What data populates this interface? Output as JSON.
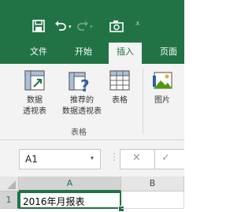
{
  "titlebar": {
    "quick_access": {
      "save_icon": "save-icon",
      "undo_icon": "undo-icon",
      "redo_icon": "redo-icon",
      "camera_icon": "camera-icon",
      "customize_icon": "customize-qat-icon"
    },
    "tabs": [
      {
        "label": "文件"
      },
      {
        "label": "开始"
      },
      {
        "label": "插入",
        "active": true
      },
      {
        "label": "页面"
      }
    ]
  },
  "ribbon": {
    "group_tables": {
      "label": "表格",
      "buttons": [
        {
          "label_line1": "数据",
          "label_line2": "透视表",
          "icon": "pivottable-icon"
        },
        {
          "label_line1": "推荐的",
          "label_line2": "数据透视表",
          "icon": "recommended-pivottable-icon"
        },
        {
          "label_line1": "表格",
          "label_line2": "",
          "icon": "table-icon"
        }
      ]
    },
    "group_illustrations": {
      "buttons": [
        {
          "label_line1": "图片",
          "icon": "picture-icon"
        }
      ]
    }
  },
  "formula_bar": {
    "name_box": "A1",
    "cancel_symbol": "✕",
    "enter_symbol": "✓"
  },
  "sheet": {
    "columns": [
      "A",
      "B"
    ],
    "rows": [
      {
        "number": "1",
        "cells": [
          "2016年月报表",
          ""
        ]
      }
    ],
    "selected_cell": "A1"
  },
  "colors": {
    "excel_green": "#217346",
    "ribbon_bg": "#f3f3f3"
  }
}
